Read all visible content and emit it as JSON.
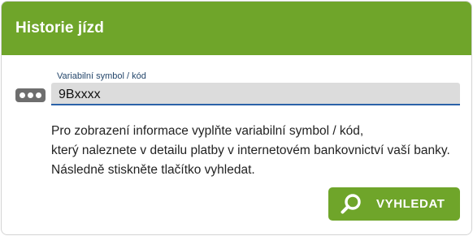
{
  "header": {
    "title": "Historie jízd"
  },
  "field": {
    "icon": "password-dots-icon",
    "label": "Variabilní symbol / kód",
    "value": "9Bxxxx"
  },
  "info": {
    "lines": [
      "Pro zobrazení informace vyplňte variabilní symbol / kód,",
      "který naleznete v detailu platby v internetovém bankovnictví vaší banky.",
      "Následně stiskněte tlačítko vyhledat."
    ]
  },
  "search_button": {
    "icon": "search-icon",
    "label": "VYHLEDAT"
  },
  "colors": {
    "brand_green": "#6fa52a",
    "input_underline": "#2b62a8",
    "label_blue": "#24466b",
    "input_background": "#dcdcdc"
  }
}
